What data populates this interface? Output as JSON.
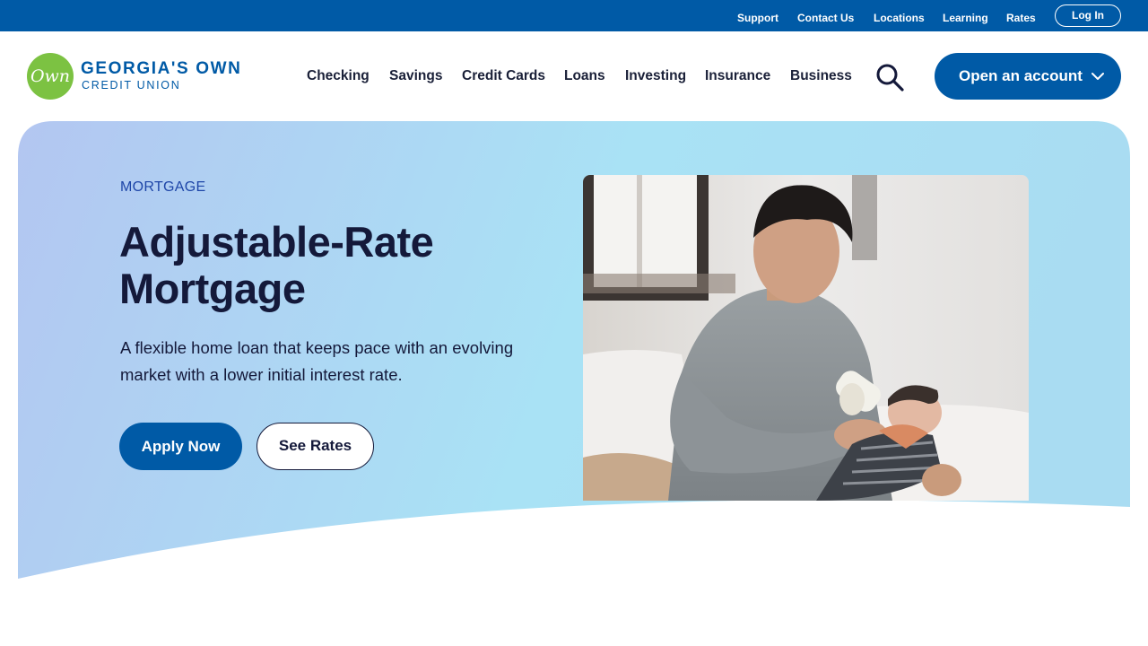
{
  "utility_nav": {
    "links": [
      "Support",
      "Contact Us",
      "Locations",
      "Learning",
      "Rates"
    ],
    "login_label": "Log In"
  },
  "brand": {
    "logo_mark": "Own",
    "name_line1": "GEORGIA'S OWN",
    "name_line2": "CREDIT UNION"
  },
  "main_nav": {
    "items": [
      "Checking",
      "Savings",
      "Credit Cards",
      "Loans",
      "Investing",
      "Insurance",
      "Business"
    ],
    "search_icon": "search-icon",
    "open_account_label": "Open an account",
    "open_account_icon": "chevron-down-icon"
  },
  "hero": {
    "eyebrow": "MORTGAGE",
    "title": "Adjustable-Rate Mortgage",
    "description": "A flexible home loan that keeps pace with an evolving market with a lower initial interest rate.",
    "primary_cta": "Apply Now",
    "secondary_cta": "See Rates"
  },
  "colors": {
    "brand_blue": "#005aa6",
    "logo_green": "#7cc242",
    "heading_navy": "#14193a",
    "eyebrow_blue": "#1e46a8",
    "hero_gradient_start": "#b3c6f1",
    "hero_gradient_end": "#a9e2f5"
  }
}
